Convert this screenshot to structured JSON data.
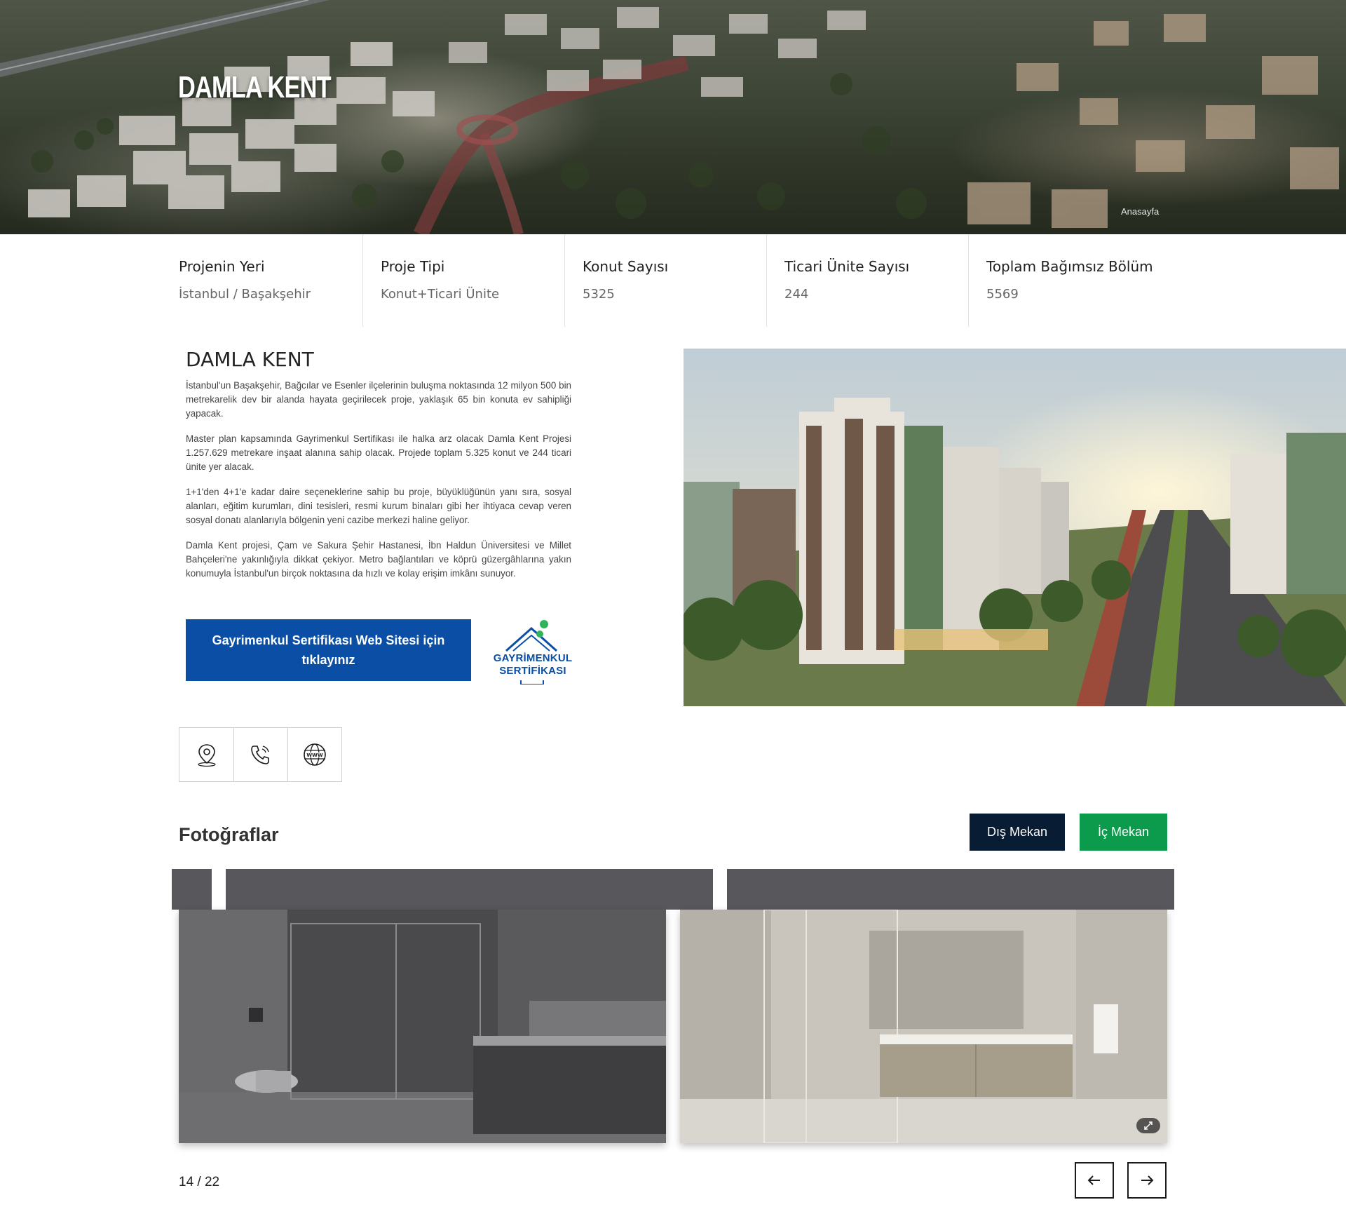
{
  "hero": {
    "title": "DAMLA KENT",
    "breadcrumb": "Anasayfa"
  },
  "stats": [
    {
      "label": "Projenin Yeri",
      "value": "İstanbul / Başakşehir"
    },
    {
      "label": "Proje Tipi",
      "value": "Konut+Ticari Ünite"
    },
    {
      "label": "Konut Sayısı",
      "value": "5325"
    },
    {
      "label": "Ticari Ünite Sayısı",
      "value": "244"
    },
    {
      "label": "Toplam Bağımsız Bölüm",
      "value": "5569"
    }
  ],
  "about": {
    "title": "DAMLA KENT",
    "paragraphs": [
      "İstanbul'un Başakşehir, Bağcılar ve Esenler ilçelerinin buluşma noktasında 12 milyon 500 bin metrekarelik dev bir alanda hayata geçirilecek proje, yaklaşık 65 bin konuta ev sahipliği yapacak.",
      "Master plan kapsamında Gayrimenkul Sertifikası ile halka arz olacak Damla Kent Projesi 1.257.629 metrekare inşaat alanına sahip olacak. Projede toplam 5.325 konut ve 244 ticari ünite yer alacak.",
      "1+1'den 4+1'e kadar daire seçeneklerine sahip bu proje, büyüklüğünün yanı sıra, sosyal alanları, eğitim kurumları, dini tesisleri, resmi kurum binaları gibi her ihtiyaca cevap veren sosyal donatı alanlarıyla bölgenin yeni cazibe merkezi haline geliyor.",
      "Damla Kent projesi, Çam ve Sakura Şehir Hastanesi, İbn Haldun Üniversitesi ve Millet Bahçeleri'ne yakınlığıyla dikkat çekiyor. Metro bağlantıları ve köprü güzergâhlarına yakın konumuyla İstanbul'un birçok noktasına da hızlı ve kolay erişim imkânı sunuyor."
    ],
    "cta_label": "Gayrimenkul Sertifikası Web Sitesi için tıklayınız",
    "logo_line1": "GAYRİMENKUL",
    "logo_line2": "SERTİFİKASI"
  },
  "icons": [
    "location-pin-icon",
    "phone-icon",
    "www-globe-icon"
  ],
  "photos": {
    "title": "Fotoğraflar",
    "filter_exterior": "Dış Mekan",
    "filter_interior": "İç Mekan",
    "counter": "14 / 22"
  },
  "colors": {
    "primary_blue": "#0a4ea5",
    "dark_navy": "#081c34",
    "green": "#0c9b4c"
  }
}
